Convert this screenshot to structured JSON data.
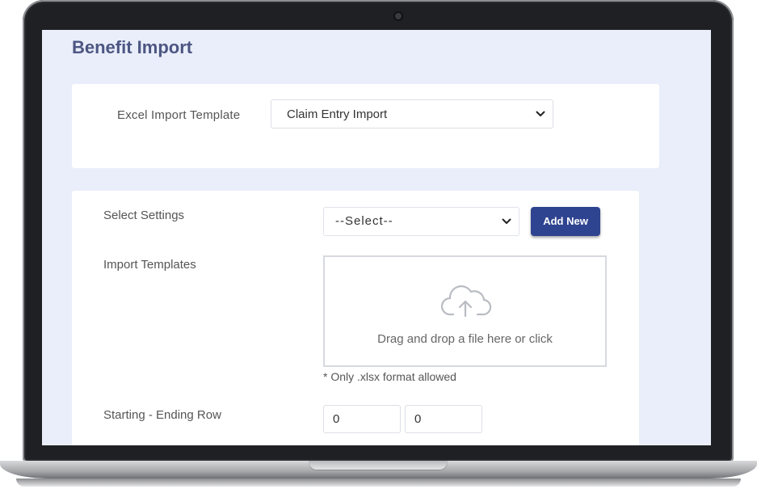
{
  "page": {
    "title": "Benefit Import"
  },
  "excel_template": {
    "label": "Excel Import Template",
    "selected": "Claim Entry Import"
  },
  "settings": {
    "label": "Select Settings",
    "selected": "--Select--",
    "add_button": "Add New"
  },
  "import_templates": {
    "label": "Import Templates",
    "dropzone_text": "Drag and drop a file here or click",
    "note": "* Only .xlsx format allowed"
  },
  "rows": {
    "label": "Starting - Ending Row",
    "start_value": "0",
    "end_value": "0"
  },
  "icons": {
    "chevron": "chevron-down-icon",
    "upload": "cloud-upload-icon",
    "camera": "webcam-icon"
  },
  "colors": {
    "accent": "#2f4490",
    "title": "#4d5682",
    "page_background": "#e9eefa"
  }
}
